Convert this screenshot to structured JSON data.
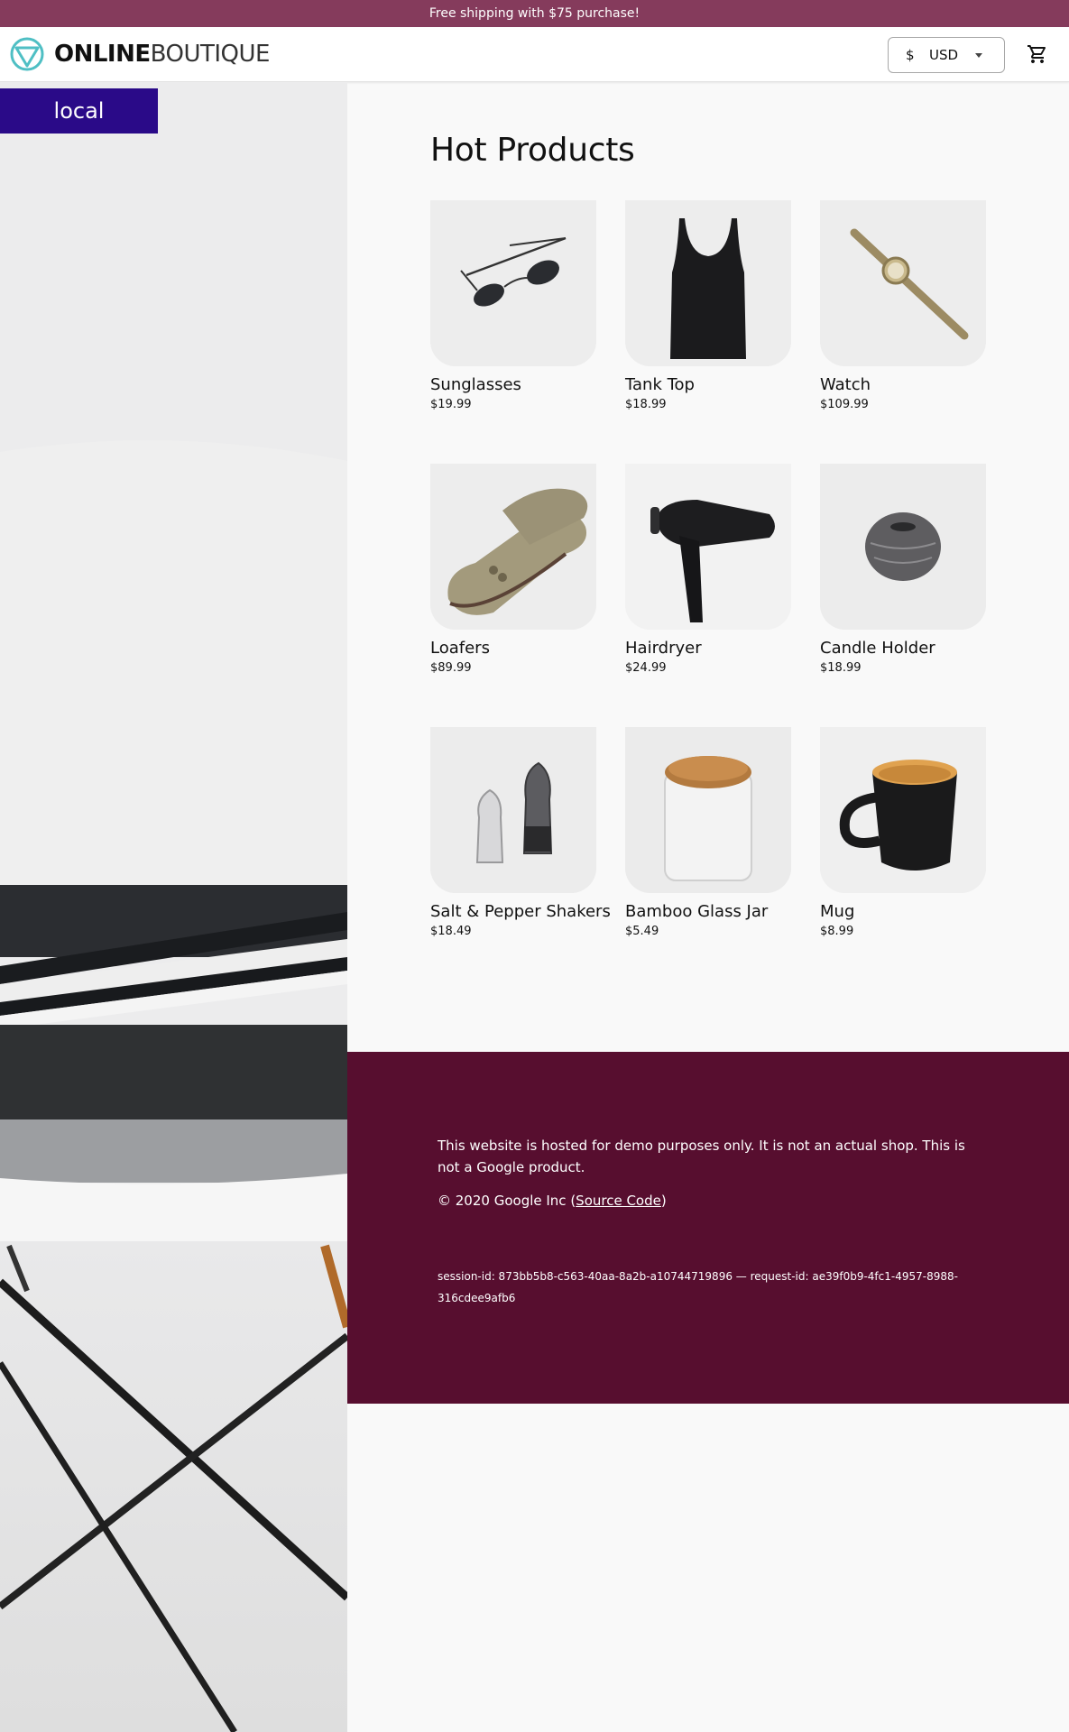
{
  "banner": {
    "text": "Free shipping with $75 purchase!"
  },
  "header": {
    "logo_bold": "ONLINE",
    "logo_light": "BOUTIQUE",
    "currency_symbol": "$",
    "currency_code": "USD",
    "cart_icon": "cart-icon"
  },
  "env_badge": {
    "label": "local"
  },
  "main": {
    "title": "Hot Products",
    "products": [
      {
        "name": "Sunglasses",
        "price": "$19.99",
        "icon": "sunglasses"
      },
      {
        "name": "Tank Top",
        "price": "$18.99",
        "icon": "tank-top"
      },
      {
        "name": "Watch",
        "price": "$109.99",
        "icon": "watch"
      },
      {
        "name": "Loafers",
        "price": "$89.99",
        "icon": "loafers"
      },
      {
        "name": "Hairdryer",
        "price": "$24.99",
        "icon": "hairdryer"
      },
      {
        "name": "Candle Holder",
        "price": "$18.99",
        "icon": "candle-holder"
      },
      {
        "name": "Salt & Pepper Shakers",
        "price": "$18.49",
        "icon": "salt-pepper-shakers"
      },
      {
        "name": "Bamboo Glass Jar",
        "price": "$5.49",
        "icon": "bamboo-glass-jar"
      },
      {
        "name": "Mug",
        "price": "$8.99",
        "icon": "mug"
      }
    ]
  },
  "footer": {
    "disclaimer": "This website is hosted for demo purposes only. It is not an actual shop. This is not a Google product.",
    "copyright_prefix": "© 2020 Google Inc (",
    "source_link": "Source Code",
    "copyright_suffix": ")",
    "ids": "session-id: 873bb5b8-c563-40aa-8a2b-a10744719896 — request-id: ae39f0b9-4fc1-4957-8988-316cdee9afb6"
  },
  "colors": {
    "banner": "#853b5c",
    "footer": "#570e2f",
    "env_badge": "#2a0a88",
    "logo_accent": "#4fbfc4"
  }
}
